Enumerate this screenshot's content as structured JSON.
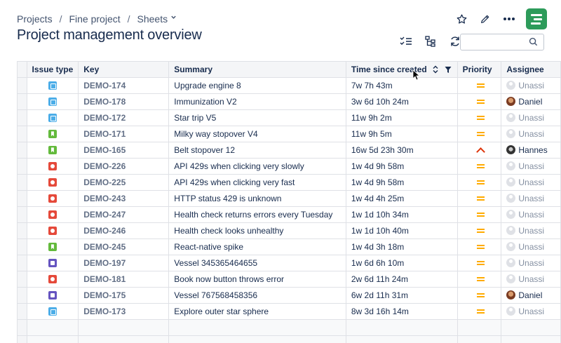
{
  "breadcrumb": {
    "items": [
      "Projects",
      "Fine project",
      "Sheets"
    ],
    "separator": "/"
  },
  "page_title": "Project management overview",
  "top_actions": [
    "star-icon",
    "pencil-icon",
    "more-icon",
    "app-logo"
  ],
  "toolbar": {
    "icons": [
      "checklist-icon",
      "hierarchy-icon",
      "refresh-icon"
    ],
    "search_value": ""
  },
  "table": {
    "columns": [
      "Issue type",
      "Key",
      "Summary",
      "Time since created",
      "Priority",
      "Assignee"
    ],
    "rows": [
      {
        "type": "task",
        "key": "DEMO-174",
        "summary": "Upgrade engine 8",
        "time": "7w 7h 43m",
        "priority": "medium",
        "assignee": "Unassi",
        "avatar": "empty"
      },
      {
        "type": "task",
        "key": "DEMO-178",
        "summary": "Immunization V2",
        "time": "3w 6d 10h 24m",
        "priority": "medium",
        "assignee": "Daniel",
        "avatar": "daniel"
      },
      {
        "type": "task",
        "key": "DEMO-172",
        "summary": "Star trip V5",
        "time": "11w 9h 2m",
        "priority": "medium",
        "assignee": "Unassi",
        "avatar": "empty"
      },
      {
        "type": "story",
        "key": "DEMO-171",
        "summary": "Milky way stopover V4",
        "time": "11w 9h 5m",
        "priority": "medium",
        "assignee": "Unassi",
        "avatar": "empty"
      },
      {
        "type": "story",
        "key": "DEMO-165",
        "summary": "Belt stopover 12",
        "time": "16w 5d 23h 30m",
        "priority": "high",
        "assignee": "Hannes",
        "avatar": "hannes"
      },
      {
        "type": "bug",
        "key": "DEMO-226",
        "summary": "API 429s when clicking very slowly",
        "time": "1w 4d 9h 58m",
        "priority": "medium",
        "assignee": "Unassi",
        "avatar": "empty"
      },
      {
        "type": "bug",
        "key": "DEMO-225",
        "summary": "API 429s when clicking very fast",
        "time": "1w 4d 9h 58m",
        "priority": "medium",
        "assignee": "Unassi",
        "avatar": "empty"
      },
      {
        "type": "bug",
        "key": "DEMO-243",
        "summary": "HTTP status 429 is unknown",
        "time": "1w 4d 4h 25m",
        "priority": "medium",
        "assignee": "Unassi",
        "avatar": "empty"
      },
      {
        "type": "bug",
        "key": "DEMO-247",
        "summary": "Health check returns errors every Tuesday",
        "time": "1w 1d 10h 34m",
        "priority": "medium",
        "assignee": "Unassi",
        "avatar": "empty"
      },
      {
        "type": "bug",
        "key": "DEMO-246",
        "summary": "Health check looks unhealthy",
        "time": "1w 1d 10h 40m",
        "priority": "medium",
        "assignee": "Unassi",
        "avatar": "empty"
      },
      {
        "type": "story",
        "key": "DEMO-245",
        "summary": "React-native spike",
        "time": "1w 4d 3h 18m",
        "priority": "medium",
        "assignee": "Unassi",
        "avatar": "empty"
      },
      {
        "type": "subtask",
        "key": "DEMO-197",
        "summary": "Vessel 345365464655",
        "time": "1w 6d 6h 10m",
        "priority": "medium",
        "assignee": "Unassi",
        "avatar": "empty"
      },
      {
        "type": "bug",
        "key": "DEMO-181",
        "summary": "Book now button throws error",
        "time": "2w 6d 11h 24m",
        "priority": "medium",
        "assignee": "Unassi",
        "avatar": "empty"
      },
      {
        "type": "subtask",
        "key": "DEMO-175",
        "summary": "Vessel 767568458356",
        "time": "6w 2d 11h 31m",
        "priority": "medium",
        "assignee": "Daniel",
        "avatar": "daniel"
      },
      {
        "type": "task",
        "key": "DEMO-173",
        "summary": "Explore outer star sphere",
        "time": "8w 3d 16h 14m",
        "priority": "medium",
        "assignee": "Unassi",
        "avatar": "empty"
      }
    ]
  },
  "colors": {
    "task": "#4bade8",
    "story": "#63ba3c",
    "bug": "#e5493a",
    "subtask": "#6554c0",
    "priority_medium": "#ffab00",
    "priority_high": "#de350b",
    "brand": "#2d9b5a"
  }
}
